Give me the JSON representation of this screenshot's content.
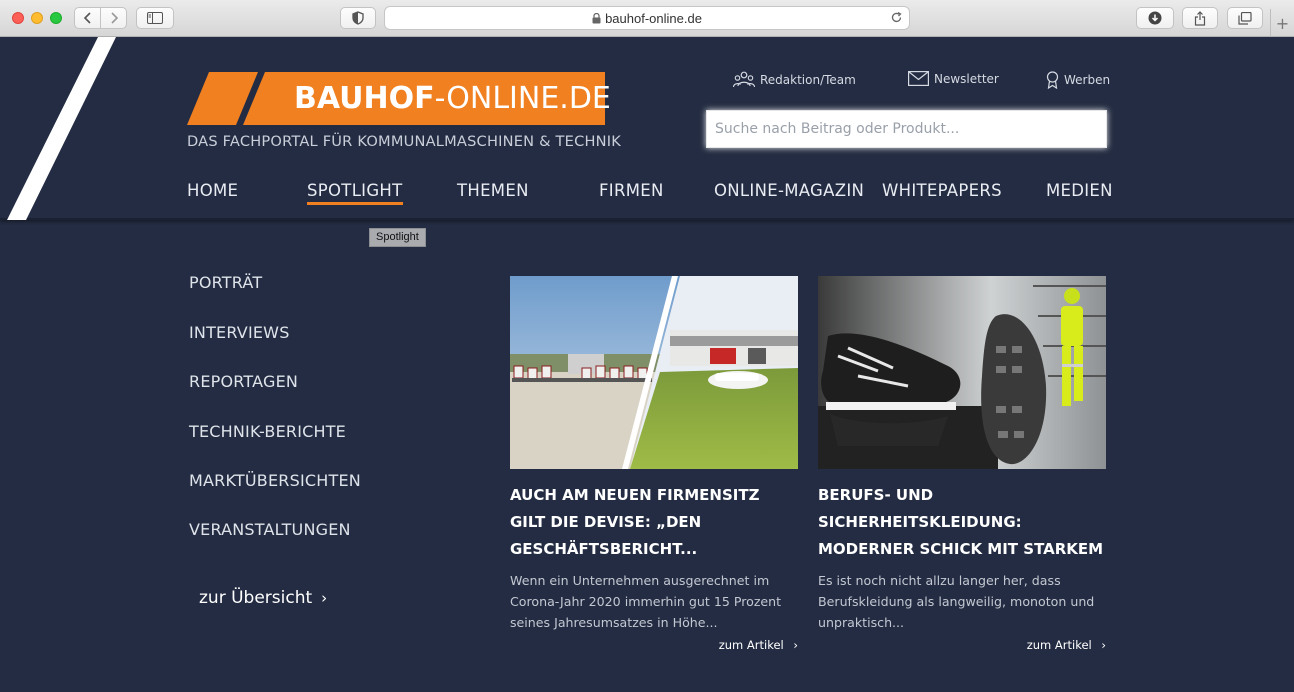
{
  "browser": {
    "url": "bauhof-online.de",
    "newtab_label": "+"
  },
  "site": {
    "logo_bold": "BAUHOF",
    "logo_rest": "-ONLINE.DE",
    "tagline": "DAS FACHPORTAL FÜR KOMMUNALMASCHINEN & TECHNIK",
    "utility": {
      "team": "Redaktion/Team",
      "newsletter": "Newsletter",
      "ads": "Werben"
    },
    "search_placeholder": "Suche nach Beitrag oder Produkt...",
    "nav": [
      {
        "label": "HOME"
      },
      {
        "label": "SPOTLIGHT"
      },
      {
        "label": "THEMEN"
      },
      {
        "label": "FIRMEN"
      },
      {
        "label": "ONLINE-MAGAZIN"
      },
      {
        "label": "WHITEPAPERS"
      },
      {
        "label": "MEDIEN"
      }
    ],
    "tooltip": "Spotlight",
    "colors": {
      "accent": "#f08020",
      "background": "#232c42"
    }
  },
  "submenu": {
    "items": [
      {
        "label": "PORTRÄT"
      },
      {
        "label": "INTERVIEWS"
      },
      {
        "label": "REPORTAGEN"
      },
      {
        "label": "TECHNIK-BERICHTE"
      },
      {
        "label": "MARKTÜBERSICHTEN"
      },
      {
        "label": "VERANSTALTUNGEN"
      }
    ],
    "overview_label": "zur Übersicht",
    "chevron": "›"
  },
  "cards": [
    {
      "title": "AUCH AM NEUEN FIRMENSITZ GILT DIE DEVISE: „DEN GESCHÄFTSBERICHT...",
      "text": "Wenn ein Unternehmen ausgerechnet im Corona-Jahr 2020 immerhin gut 15 Prozent seines Jahresumsatzes in Höhe...",
      "link": "zum Artikel"
    },
    {
      "title": "BERUFS- UND SICHERHEITSKLEIDUNG: MODERNER SCHICK MIT STARKEM DRANG ZUR...",
      "text": "Es ist noch nicht allzu langer her, dass Berufskleidung als langweilig, monoton und unpraktisch...",
      "link": "zum Artikel"
    }
  ]
}
